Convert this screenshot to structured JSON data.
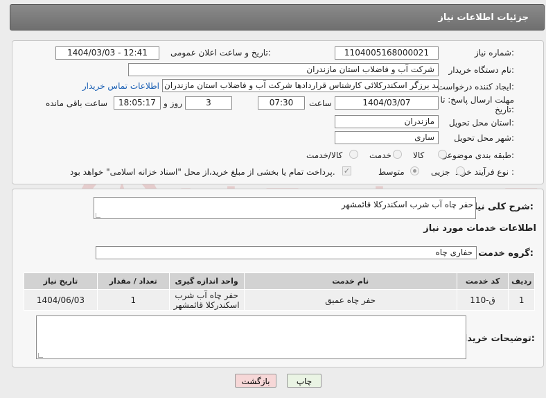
{
  "header": {
    "title": "جزئیات اطلاعات نیاز"
  },
  "watermark": {
    "text": "AriaTender.neT"
  },
  "details": {
    "need_number_label": "شماره نیاز:",
    "need_number": "1104005168000021",
    "announce_label": "تاریخ و ساعت اعلان عمومی:",
    "announce_value": "1404/03/03 - 12:41",
    "buyer_org_label": "نام دستگاه خریدار:",
    "buyer_org": "شرکت آب و فاضلاب استان مازندران",
    "creator_label": "ایجاد کننده درخواست:",
    "creator": "احمد برزگر اسکندرکلائی کارشناس قراردادها شرکت آب و فاضلاب استان مازندران",
    "contact_link": "اطلاعات تماس خریدار",
    "deadline_label_1": "مهلت ارسال پاسخ: تا",
    "deadline_label_2": "تاریخ:",
    "deadline_date": "1404/03/07",
    "time_label": "ساعت",
    "deadline_time": "07:30",
    "days_value": "3",
    "days_label": "روز و",
    "remaining_time": "18:05:17",
    "remaining_label": "ساعت باقی مانده",
    "province_label": "استان محل تحویل:",
    "province": "مازندران",
    "city_label": "شهر محل تحویل:",
    "city": "ساری",
    "category_label": "طبقه بندی موضوعی:",
    "category_options": [
      "کالا",
      "خدمت",
      "کالا/خدمت"
    ],
    "category_selected": "",
    "process_label": "نوع فرآیند خرید :",
    "process_options": [
      "جزیی",
      "متوسط"
    ],
    "process_selected": "متوسط",
    "payment_note": "پرداخت تمام یا بخشی از مبلغ خرید،از محل \"اسناد خزانه اسلامی\" خواهد بود."
  },
  "summary": {
    "desc_label": "شرح کلی نیاز:",
    "desc_value": "حفر چاه آب شرب اسکندرکلا قائمشهر",
    "services_title": "اطلاعات خدمات مورد نیاز",
    "group_label": "گروه خدمت:",
    "group_value": "حفاری چاه",
    "table": {
      "headers": [
        "ردیف",
        "کد خدمت",
        "نام خدمت",
        "واحد اندازه گیری",
        "تعداد / مقدار",
        "تاریخ نیاز"
      ],
      "rows": [
        [
          "1",
          "ق-110",
          "حفر چاه عمیق",
          "حفر چاه آب شرب اسکندرکلا قائمشهر",
          "1",
          "1404/06/03"
        ]
      ]
    },
    "buyer_notes_label": "توضیحات خریدار:",
    "buyer_notes_value": ""
  },
  "buttons": {
    "print": "چاپ",
    "back": "بازگشت"
  },
  "colors": {
    "link": "#1a5fb4",
    "back_button_bg": "#f6d7d7",
    "print_button_bg": "#eaf4e4"
  }
}
